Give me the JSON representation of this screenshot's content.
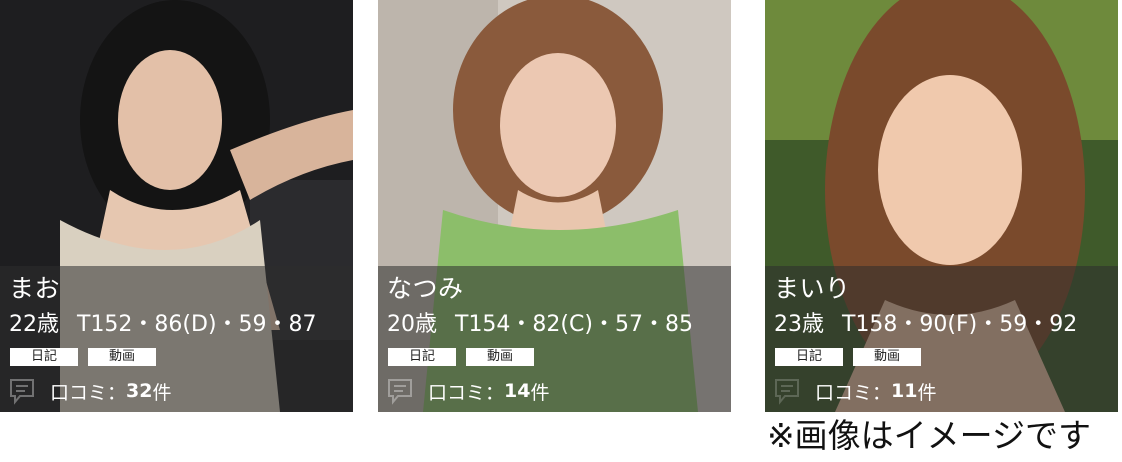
{
  "cards": [
    {
      "name": "まお",
      "age": "22歳",
      "measurements": "T152・86(D)・59・87",
      "tags": [
        "日記",
        "動画"
      ],
      "review_label": "口コミ：",
      "review_count": "32",
      "review_unit": "件"
    },
    {
      "name": "なつみ",
      "age": "20歳",
      "measurements": "T154・82(C)・57・85",
      "tags": [
        "日記",
        "動画"
      ],
      "review_label": "口コミ：",
      "review_count": "14",
      "review_unit": "件"
    },
    {
      "name": "まいり",
      "age": "23歳",
      "measurements": "T158・90(F)・59・92",
      "tags": [
        "日記",
        "動画"
      ],
      "review_label": "口コミ：",
      "review_count": "11",
      "review_unit": "件"
    }
  ],
  "footer_note": "※画像はイメージです",
  "colors": {
    "overlay": "#2d2d2d",
    "tag_bg": "#ffffff",
    "text": "#ffffff"
  }
}
